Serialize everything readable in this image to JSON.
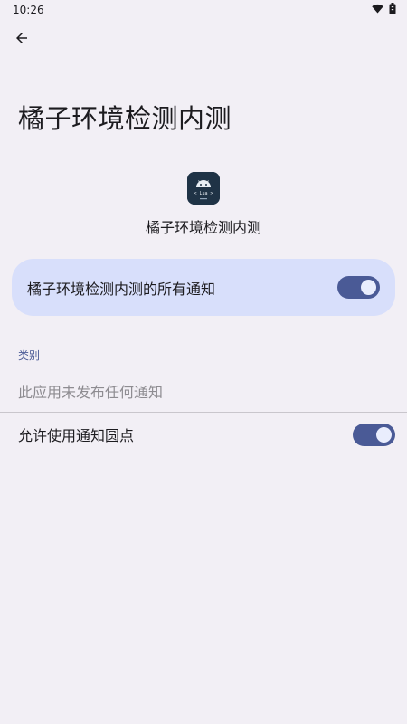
{
  "status_bar": {
    "time": "10:26",
    "icons": [
      "wifi-icon",
      "battery-icon"
    ]
  },
  "header": {
    "back_icon": "arrow-back-icon",
    "title": "橘子环境检测内测"
  },
  "app": {
    "icon": "android-app-icon",
    "icon_text": "< Lua >",
    "name": "橘子环境检测内测"
  },
  "all_notifications": {
    "label": "橘子环境检测内测的所有通知",
    "enabled": true
  },
  "categories": {
    "section_label": "类别",
    "empty_message": "此应用未发布任何通知"
  },
  "notification_dot": {
    "label": "允许使用通知圆点",
    "enabled": true
  },
  "colors": {
    "background": "#f2eff5",
    "card": "#d8dffb",
    "accent": "#4a5a96",
    "knob": "#e9edfd",
    "muted_text": "#8e8c91",
    "app_icon_bg": "#1f3346"
  }
}
